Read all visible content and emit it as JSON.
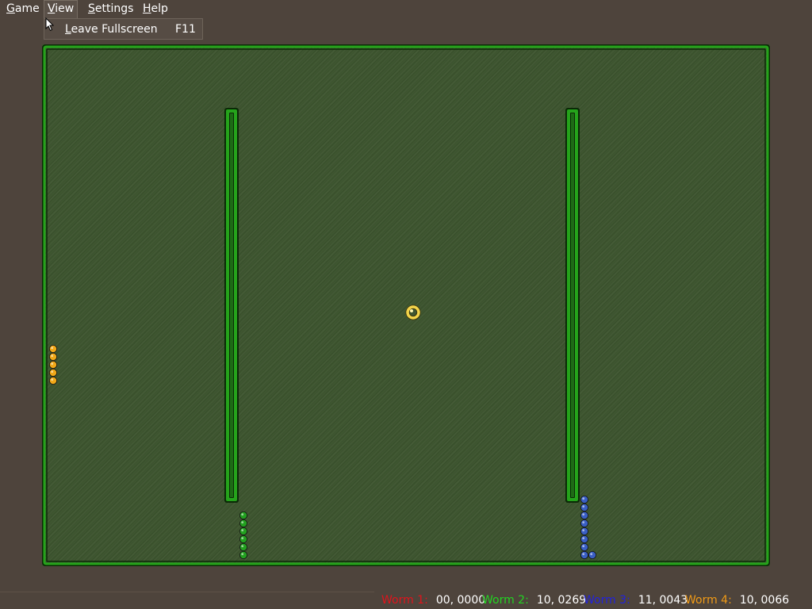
{
  "menubar": {
    "items": [
      {
        "label_u": "G",
        "label_rest": "ame",
        "active": false
      },
      {
        "label_u": "V",
        "label_rest": "iew",
        "active": true
      },
      {
        "label_u": "S",
        "label_rest": "ettings",
        "active": false
      },
      {
        "label_u": "H",
        "label_rest": "elp",
        "active": false
      }
    ]
  },
  "view_menu": {
    "item_u": "L",
    "item_rest": "eave Fullscreen",
    "accelerator": "F11"
  },
  "game": {
    "wall_color": "#25a31b",
    "wall_dark": "#0a2a06",
    "bonus_color": "#f2d34a",
    "worm_colors": {
      "worm2": "#23a020",
      "worm3": "#3a5fc4",
      "worm4": "#f0a818"
    },
    "worm_segments": {
      "worm2": 6,
      "worm3": 9,
      "worm4": 5
    }
  },
  "statusbar": {
    "scores": [
      {
        "name": "Worm 1:",
        "value": "00, 0000",
        "color": "#e0141c"
      },
      {
        "name": "Worm 2:",
        "value": "10, 0269",
        "color": "#22d422"
      },
      {
        "name": "Worm 3:",
        "value": "11, 0043",
        "color": "#2222dd"
      },
      {
        "name": "Worm 4:",
        "value": "10, 0066",
        "color": "#f09a16"
      }
    ]
  }
}
